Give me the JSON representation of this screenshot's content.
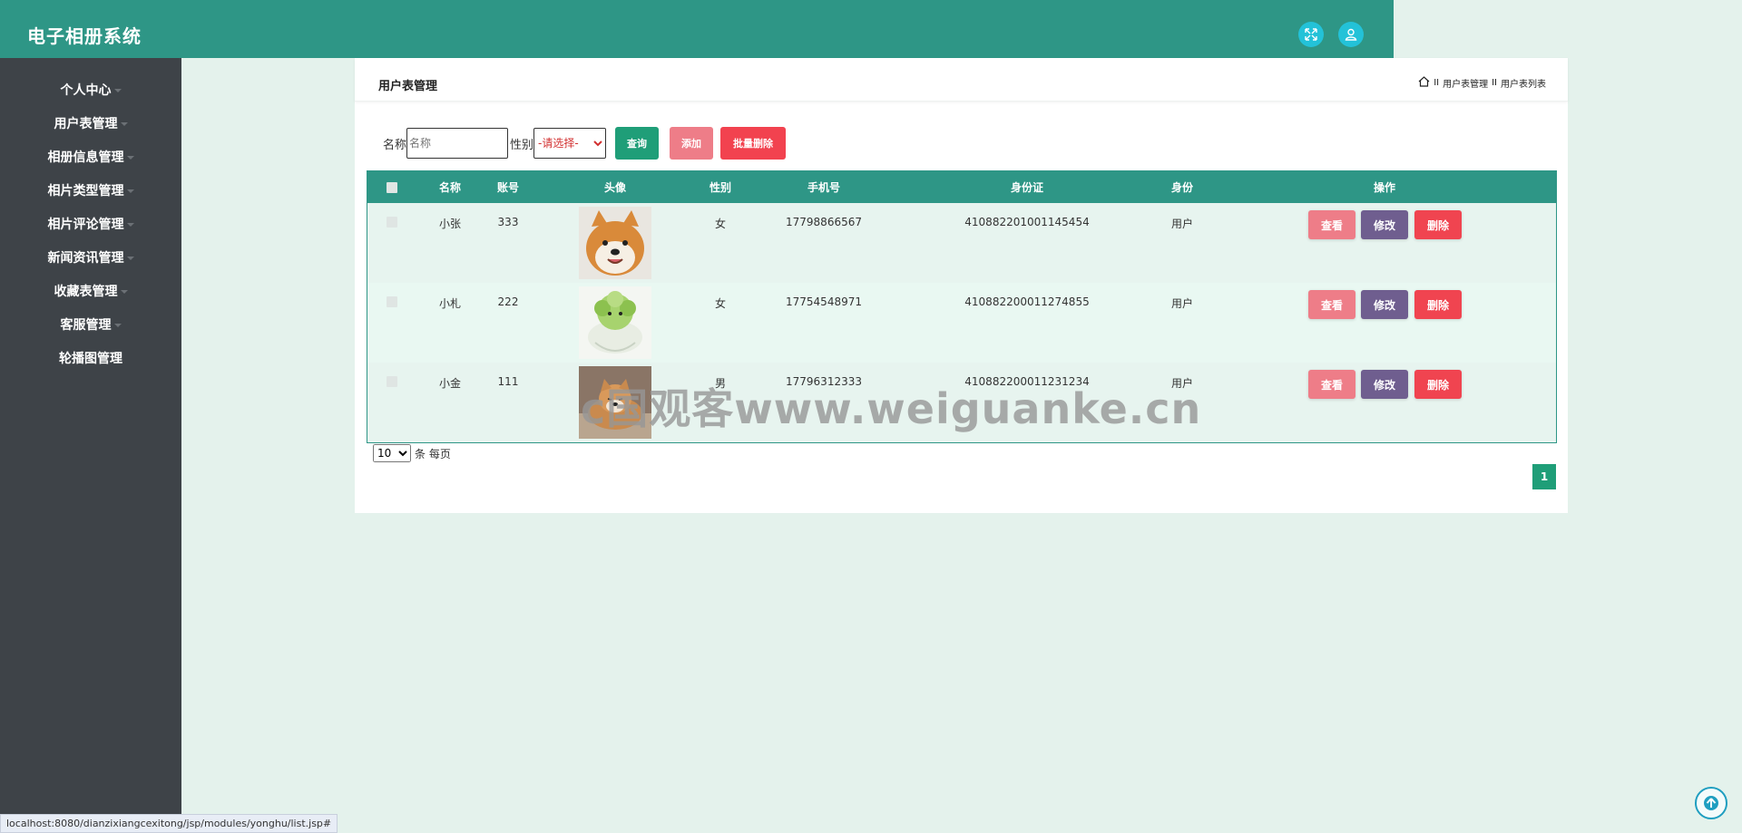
{
  "app": {
    "title": "电子相册系统"
  },
  "header_icons": [
    "fullscreen-icon",
    "user-icon"
  ],
  "sidebar": {
    "items": [
      {
        "label": "个人中心",
        "has_caret": true
      },
      {
        "label": "用户表管理",
        "has_caret": true
      },
      {
        "label": "相册信息管理",
        "has_caret": true
      },
      {
        "label": "相片类型管理",
        "has_caret": true
      },
      {
        "label": "相片评论管理",
        "has_caret": true
      },
      {
        "label": "新闻资讯管理",
        "has_caret": true
      },
      {
        "label": "收藏表管理",
        "has_caret": true
      },
      {
        "label": "客服管理",
        "has_caret": true
      },
      {
        "label": "轮播图管理",
        "has_caret": false
      }
    ]
  },
  "panel": {
    "title": "用户表管理",
    "breadcrumb": [
      "用户表管理",
      "用户表列表"
    ],
    "breadcrumb_sep": "II"
  },
  "filters": {
    "name_label": "名称",
    "name_placeholder": "名称",
    "sex_label": "性别",
    "sex_selected": "-请选择-",
    "query_label": "查询",
    "add_label": "添加",
    "batch_delete_label": "批量删除"
  },
  "table": {
    "columns": [
      "名称",
      "账号",
      "头像",
      "性别",
      "手机号",
      "身份证",
      "身份",
      "操作"
    ],
    "rows": [
      {
        "name": "小张",
        "account": "333",
        "sex": "女",
        "phone": "17798866567",
        "id_card": "410882201001145454",
        "role": "用户",
        "avatar": "shiba-inu-smiling"
      },
      {
        "name": "小札",
        "account": "222",
        "sex": "女",
        "phone": "17754548971",
        "id_card": "410882200011274855",
        "role": "用户",
        "avatar": "cabbage-creature"
      },
      {
        "name": "小金",
        "account": "111",
        "sex": "男",
        "phone": "17796312333",
        "id_card": "410882200011231234",
        "role": "用户",
        "avatar": "shiba-inu-lying"
      }
    ],
    "actions": {
      "view": "查看",
      "edit": "修改",
      "delete": "删除"
    }
  },
  "pagination": {
    "page_size": "10",
    "page_size_label": "条 每页",
    "current_page": "1"
  },
  "watermark": "c国观客www.weiguanke.cn",
  "status_url": "localhost:8080/dianzixiangcexitong/jsp/modules/yonghu/list.jsp#",
  "colors": {
    "topbar": "#2e9686",
    "sidebar": "#3e4348",
    "page_bg": "#e4f2ec",
    "row_a": "#e7f4ef",
    "row_b": "#e9f8f2",
    "query_btn": "#1f9e78",
    "add_btn": "#ee7d88",
    "batch_delete_btn": "#f2424f",
    "view_btn": "#ee7d88",
    "edit_btn": "#6f5e8f",
    "delete_btn": "#f04450"
  }
}
